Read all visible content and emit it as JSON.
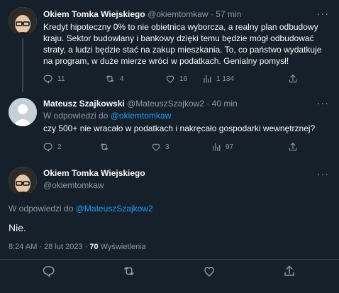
{
  "tweet1": {
    "name": "Okiem Tomka Wiejskiego",
    "handle": "@okiemtomkaw",
    "separator": "·",
    "time": "57 min",
    "text": "Kredyt hipoteczny 0% to nie obietnica wyborcza, a realny plan odbudowy kraju. Sektor budowlany i bankowy dzięki temu będzie mógł odbudować straty, a ludzi będzie stać na zakup mieszkania. To, co państwo wydatkuje na program, w duże mierze wróci w podatkach. Genialny pomysł!",
    "replies": "11",
    "retweets": "4",
    "likes": "16",
    "views": "1 134"
  },
  "tweet2": {
    "name": "Mateusz Szajkowski",
    "handle": "@MateuszSzajkow2",
    "separator": "·",
    "time": "40 min",
    "reply_prefix": "W odpowiedzi do",
    "reply_handle": "@okiemtomkaw",
    "text": "czy 500+ nie wracało w podatkach i nakręcało gospodarki wewnętrznej?",
    "replies": "2",
    "retweets": "",
    "likes": "3",
    "views": "97"
  },
  "tweet3": {
    "name": "Okiem Tomka Wiejskiego",
    "handle": "@okiemtomkaw",
    "reply_prefix": "W odpowiedzi do",
    "reply_handle": "@MateuszSzajkow2",
    "text": "Nie.",
    "timestamp": "8:24 AM · 28 lut 2023 ·",
    "view_count": "70",
    "views_label": "Wyświetlenia"
  },
  "more_label": "···",
  "icons": {
    "reply": "reply-icon",
    "retweet": "retweet-icon",
    "like": "heart-icon",
    "views": "views-icon",
    "share": "share-icon",
    "more": "more-icon"
  },
  "colors": {
    "background": "#15202b",
    "text": "#f7f9f9",
    "secondary": "#8b98a5",
    "accent": "#1d9bf0",
    "border": "#38444d"
  }
}
